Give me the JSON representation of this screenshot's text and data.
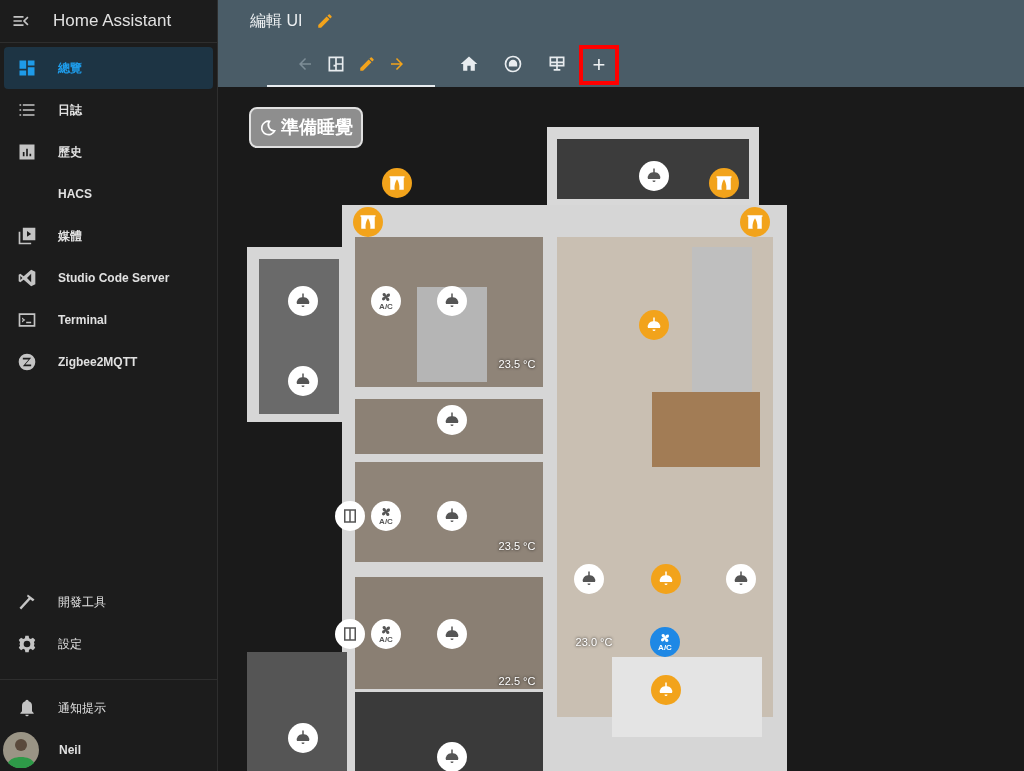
{
  "sidebar": {
    "title": "Home Assistant",
    "items": [
      {
        "kind": "dashboard",
        "label": "總覽",
        "selected": true
      },
      {
        "kind": "list",
        "label": "日誌",
        "selected": false
      },
      {
        "kind": "chart",
        "label": "歷史",
        "selected": false
      },
      {
        "kind": "none",
        "label": "HACS",
        "selected": false
      },
      {
        "kind": "media",
        "label": "媒體",
        "selected": false
      },
      {
        "kind": "code",
        "label": "Studio Code Server",
        "selected": false
      },
      {
        "kind": "terminal",
        "label": "Terminal",
        "selected": false
      },
      {
        "kind": "zigbee",
        "label": "Zigbee2MQTT",
        "selected": false
      }
    ],
    "bottom_items": [
      {
        "kind": "hammer",
        "label": "開發工具"
      },
      {
        "kind": "gear",
        "label": "設定"
      }
    ],
    "notifications": {
      "label": "通知提示"
    },
    "user": {
      "name": "Neil"
    }
  },
  "header": {
    "title": "編輯 UI",
    "tabs": [
      {
        "kind": "floorplan",
        "selected": true
      },
      {
        "kind": "home",
        "selected": false
      },
      {
        "kind": "robot",
        "selected": false
      },
      {
        "kind": "table",
        "selected": false
      }
    ],
    "add_tab": {
      "label": "+",
      "highlighted": true
    }
  },
  "scene_button": {
    "label": "準備睡覺"
  },
  "floorplan": {
    "markers": [
      {
        "kind": "curtain",
        "on": true
      },
      {
        "kind": "lamp",
        "on": false
      },
      {
        "kind": "curtain",
        "on": true
      },
      {
        "kind": "curtain",
        "on": true
      },
      {
        "kind": "curtain",
        "on": true
      },
      {
        "kind": "lamp",
        "on": false
      },
      {
        "kind": "ac",
        "on": false,
        "label": "A/C"
      },
      {
        "kind": "lamp",
        "on": false
      },
      {
        "kind": "lamp",
        "on": true
      },
      {
        "kind": "lamp",
        "on": false
      },
      {
        "kind": "lamp",
        "on": false
      },
      {
        "kind": "door",
        "on": false
      },
      {
        "kind": "ac",
        "on": false,
        "label": "A/C"
      },
      {
        "kind": "lamp",
        "on": false
      },
      {
        "kind": "lamp",
        "on": false
      },
      {
        "kind": "lamp",
        "on": true
      },
      {
        "kind": "lamp",
        "on": false
      },
      {
        "kind": "door",
        "on": false
      },
      {
        "kind": "ac",
        "on": false,
        "label": "A/C"
      },
      {
        "kind": "lamp",
        "on": false
      },
      {
        "kind": "ac",
        "on": true,
        "label": "A/C"
      },
      {
        "kind": "lamp",
        "on": true
      },
      {
        "kind": "lamp",
        "on": false
      },
      {
        "kind": "lamp",
        "on": false
      }
    ],
    "temperatures": [
      "23.5 °C",
      "23.5 °C",
      "23.0 °C",
      "22.5 °C"
    ]
  }
}
